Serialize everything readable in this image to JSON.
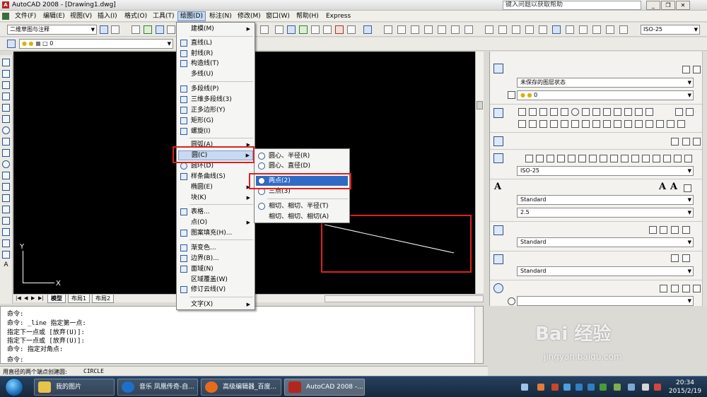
{
  "window": {
    "title": "AutoCAD 2008 - [Drawing1.dwg]",
    "help_placeholder": "键入问题以获取帮助",
    "min": "_",
    "restore": "❐",
    "close": "✕"
  },
  "menubar": {
    "items": [
      "文件(F)",
      "编辑(E)",
      "视图(V)",
      "插入(I)",
      "格式(O)",
      "工具(T)",
      "绘图(D)",
      "标注(N)",
      "修改(M)",
      "窗口(W)",
      "帮助(H)",
      "Express"
    ]
  },
  "toolbar": {
    "workspace": "二维草图与注释",
    "layer_value": "0",
    "dimstyle": "ISO-25"
  },
  "draw_menu": {
    "items": [
      {
        "label": "建模(M)",
        "submenu": true
      },
      {
        "label": "直线(L)"
      },
      {
        "label": "射线(R)"
      },
      {
        "label": "构造线(T)"
      },
      {
        "label": "多线(U)"
      },
      {
        "label": "多段线(P)"
      },
      {
        "label": "三维多段线(3)"
      },
      {
        "label": "正多边形(Y)"
      },
      {
        "label": "矩形(G)"
      },
      {
        "label": "螺旋(I)"
      },
      {
        "label": "圆弧(A)",
        "submenu": true
      },
      {
        "label": "圆(C)",
        "submenu": true
      },
      {
        "label": "圆环(D)"
      },
      {
        "label": "样条曲线(S)"
      },
      {
        "label": "椭圆(E)",
        "submenu": true
      },
      {
        "label": "块(K)",
        "submenu": true
      },
      {
        "label": "表格..."
      },
      {
        "label": "点(O)",
        "submenu": true
      },
      {
        "label": "图案填充(H)..."
      },
      {
        "label": "渐变色..."
      },
      {
        "label": "边界(B)..."
      },
      {
        "label": "面域(N)"
      },
      {
        "label": "区域覆盖(W)"
      },
      {
        "label": "修订云线(V)"
      },
      {
        "label": "文字(X)",
        "submenu": true
      }
    ]
  },
  "circle_menu": {
    "items": [
      "圆心、半径(R)",
      "圆心、直径(D)",
      "两点(2)",
      "三点(3)",
      "相切、相切、半径(T)",
      "相切、相切、相切(A)"
    ]
  },
  "drawing": {
    "ucs_y": "Y",
    "ucs_x": "X",
    "tabs": [
      "模型",
      "布局1",
      "布局2"
    ]
  },
  "command": {
    "lines": [
      "命令:",
      "命令: _line 指定第一点:",
      "指定下一点或 [放弃(U)]:",
      "指定下一点或 [放弃(U)]:",
      "命令: 指定对角点:",
      "命令:"
    ]
  },
  "status": {
    "prompt": "用直径的两个端点创建圆:",
    "command": "CIRCLE"
  },
  "right_panel": {
    "layer_state": "未保存的图层状态",
    "layer_value": "0",
    "dimstyle": "ISO-25",
    "text_style": "Standard",
    "text_height": "2.5",
    "mleader_style": "Standard",
    "table_style": "Standard"
  },
  "taskbar": {
    "buttons": [
      "我的图片",
      "音乐 凤凰传奇-自...",
      "高级编辑器_百度...",
      "AutoCAD 2008 -..."
    ],
    "time": "20:34",
    "date": "2015/2/19"
  },
  "watermark": {
    "text": "Bai  经验",
    "url": "jingyan.baidu.com"
  },
  "colors": {
    "highlight": "#e02020",
    "menu_hover": "#316ac5",
    "canvas": "#000000"
  }
}
